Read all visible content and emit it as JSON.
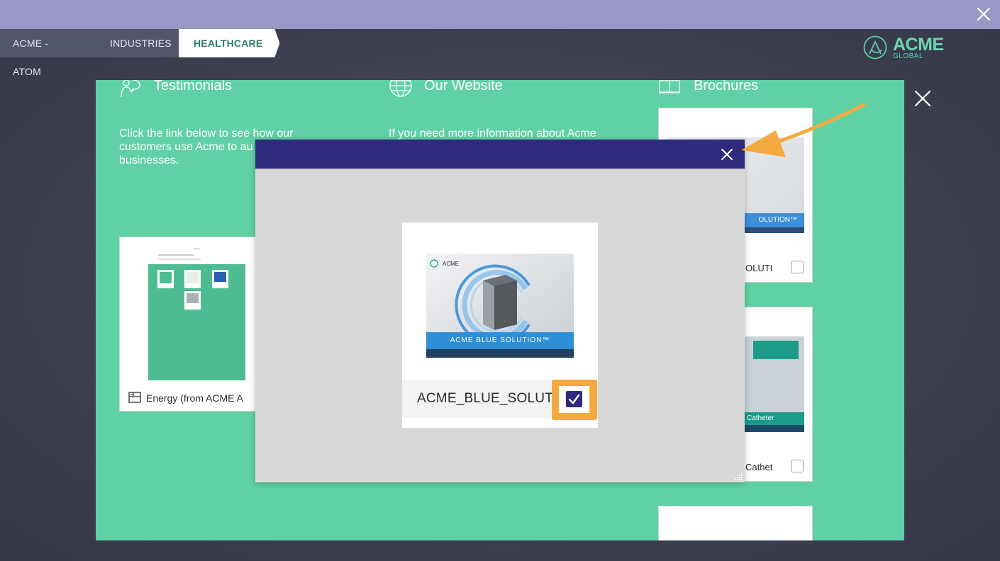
{
  "top_bar": {
    "close_icon": "close-icon"
  },
  "breadcrumb": [
    {
      "label": "ACME - ATOM"
    },
    {
      "label": "INDUSTRIES"
    },
    {
      "label": "HEALTHCARE"
    }
  ],
  "logo": {
    "title": "ACME",
    "subtitle": "GLOBAL"
  },
  "columns": {
    "testimonials": {
      "title": "Testimonials",
      "icon": "people-talking-icon",
      "description_line1": "Click the link below to see how our",
      "description_line2": "customers use Acme to au",
      "description_line3": "businesses.",
      "card_label": "Energy (from ACME A",
      "card_icon": "layout-icon",
      "thumb_title": "Energy"
    },
    "website": {
      "title": "Our Website",
      "icon": "globe-icon",
      "description_line1": "If you need more information about Acme"
    },
    "brochures": {
      "title": "Brochures",
      "icon": "open-book-icon",
      "items": [
        {
          "label": "OLUTI",
          "banner": "OLUTION™",
          "checked": false
        },
        {
          "label": "Cathet",
          "banner": "Catheter",
          "checked": false
        }
      ]
    }
  },
  "dialog": {
    "preview_name": "ACME_BLUE_SOLUT...",
    "preview_banner": "ACME BLUE SOLUTION™",
    "preview_logo": "ACME",
    "checked": true,
    "accent": "#2e2a7c",
    "highlight": "#f4a940"
  },
  "colors": {
    "panel": "#5fd1a4",
    "top_bar": "#9a97c4",
    "dialog_header": "#2e2a7c",
    "annotation_arrow": "#f4a940"
  }
}
